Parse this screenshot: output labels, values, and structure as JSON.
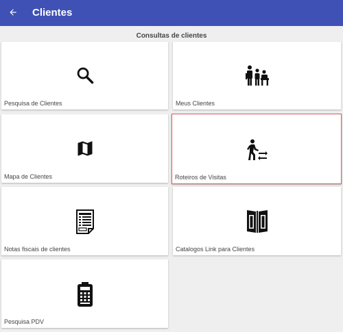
{
  "appbar": {
    "title": "Clientes",
    "back_icon": "arrow-left-icon",
    "color": "#3f51b5"
  },
  "section": {
    "title": "Consultas de clientes"
  },
  "cards": [
    {
      "label": "Pesquisa de Clientes",
      "icon": "search-icon"
    },
    {
      "label": "Meus Clientes",
      "icon": "family-icon"
    },
    {
      "label": "Mapa de Clientes",
      "icon": "map-icon"
    },
    {
      "label": "Roteiros de Visitas",
      "icon": "walking-route-icon",
      "selected": true
    },
    {
      "label": "Notas fiscais de clientes",
      "icon": "invoice-icon"
    },
    {
      "label": "Catalogos Link para Clientes",
      "icon": "catalog-book-icon"
    },
    {
      "label": "Pesquisa PDV",
      "icon": "pos-terminal-icon"
    }
  ],
  "colors": {
    "selected_border": "#e05a5a",
    "background": "#efefef"
  }
}
